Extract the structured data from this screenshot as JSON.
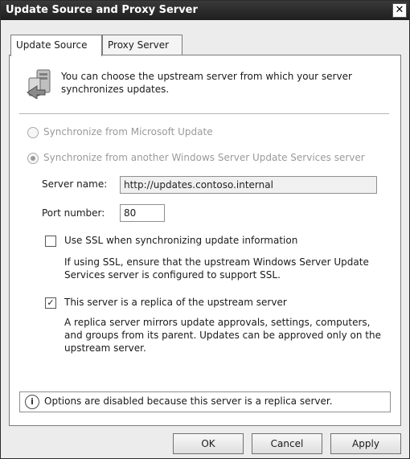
{
  "window": {
    "title": "Update Source and Proxy Server",
    "close_glyph": "✕"
  },
  "tabs": [
    {
      "label": "Update Source",
      "active": true
    },
    {
      "label": "Proxy Server",
      "active": false
    }
  ],
  "header": {
    "icon": "server-sync-icon",
    "description": "You can choose the upstream server from which your server synchronizes updates."
  },
  "options": {
    "sync_microsoft": {
      "label": "Synchronize from Microsoft Update",
      "checked": false,
      "enabled": false
    },
    "sync_wsus": {
      "label": "Synchronize from another Windows Server Update Services server",
      "checked": true,
      "enabled": false
    }
  },
  "server_name": {
    "label": "Server name:",
    "value": "http://updates.contoso.internal"
  },
  "port_number": {
    "label": "Port number:",
    "value": "80"
  },
  "use_ssl": {
    "label": "Use SSL when synchronizing update information",
    "checked": false,
    "note": "If using SSL, ensure that the upstream Windows Server Update Services server is configured to support SSL."
  },
  "replica": {
    "label": "This server is a replica of the upstream server",
    "checked": true,
    "note": "A replica server mirrors update approvals, settings, computers, and groups from its parent. Updates can be approved only on the upstream server."
  },
  "status": {
    "icon": "info-icon",
    "text": "Options are disabled because this server is a replica server."
  },
  "buttons": {
    "ok": "OK",
    "cancel": "Cancel",
    "apply": "Apply"
  }
}
